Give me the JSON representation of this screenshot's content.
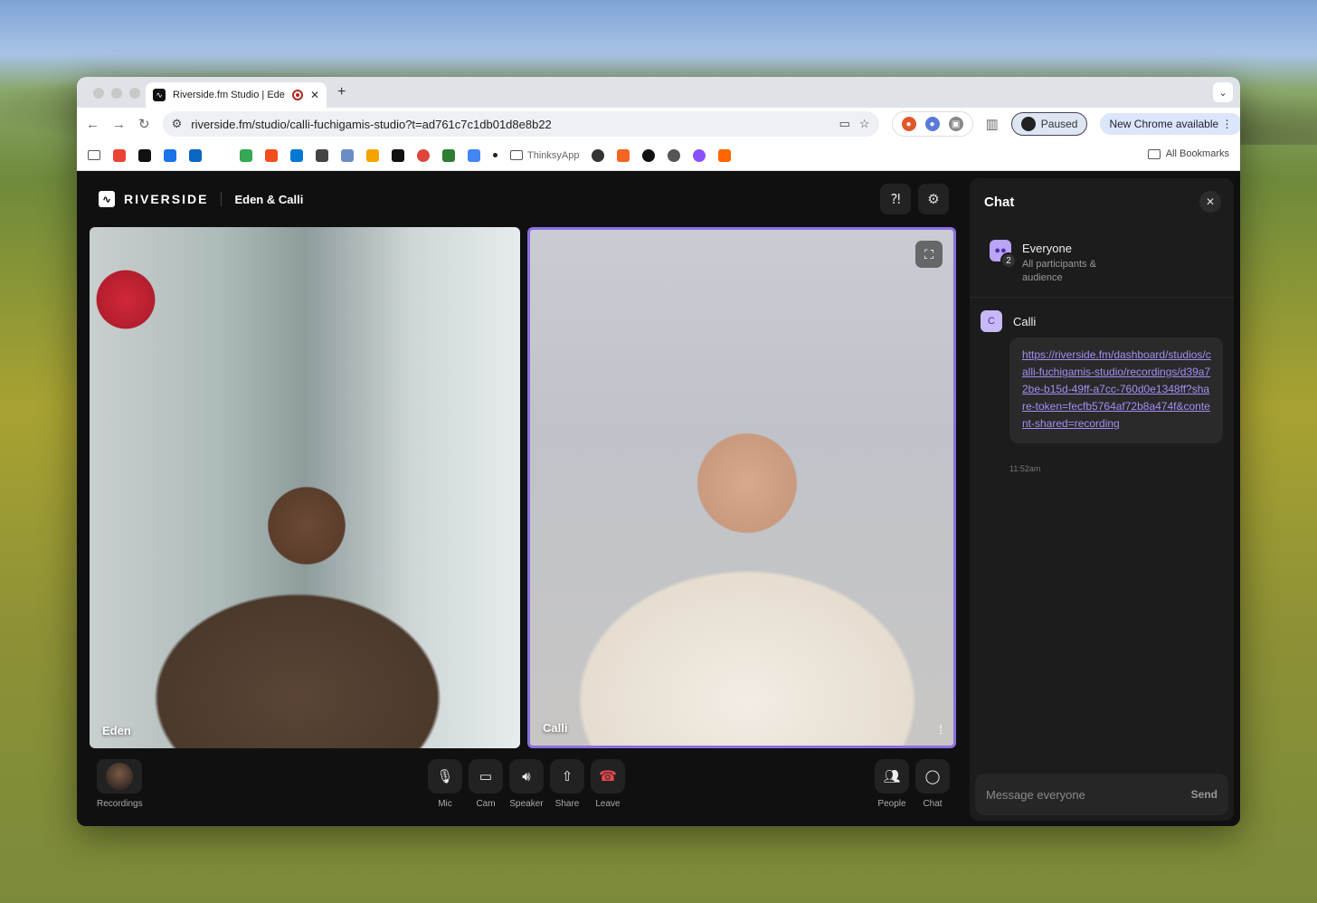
{
  "browser": {
    "tab_title": "Riverside.fm Studio | Eden",
    "tab_close": "✕",
    "new_tab": "+",
    "url": "riverside.fm/studio/calli-fuchigamis-studio?t=ad761c7c1db01d8e8b22",
    "profile_status": "Paused",
    "update_label": "New Chrome available",
    "bookmarks": {
      "folder_label": "ThinksyApp",
      "all_bookmarks": "All Bookmarks"
    }
  },
  "app": {
    "brand": "RIVERSIDE",
    "room_name": "Eden & Calli",
    "participants": [
      {
        "name": "Eden"
      },
      {
        "name": "Calli"
      }
    ],
    "controls": {
      "recordings": "Recordings",
      "mic": "Mic",
      "cam": "Cam",
      "speaker": "Speaker",
      "share": "Share",
      "leave": "Leave",
      "people": "People",
      "chat": "Chat"
    }
  },
  "chat": {
    "title": "Chat",
    "channel": {
      "name": "Everyone",
      "description": "All participants & audience",
      "count": "2"
    },
    "messages": [
      {
        "author": "Calli",
        "author_initial": "C",
        "text": "https://riverside.fm/dashboard/studios/calli-fuchigamis-studio/recordings/d39a72be-b15d-49ff-a7cc-760d0e1348ff?share-token=fecfb5764af72b8a474f&content-shared=recording",
        "time": "11:52am"
      }
    ],
    "composer": {
      "placeholder": "Message everyone",
      "send": "Send"
    }
  },
  "colors": {
    "accent": "#8b6fe0",
    "link": "#a58df2",
    "leave": "#e5484d"
  }
}
